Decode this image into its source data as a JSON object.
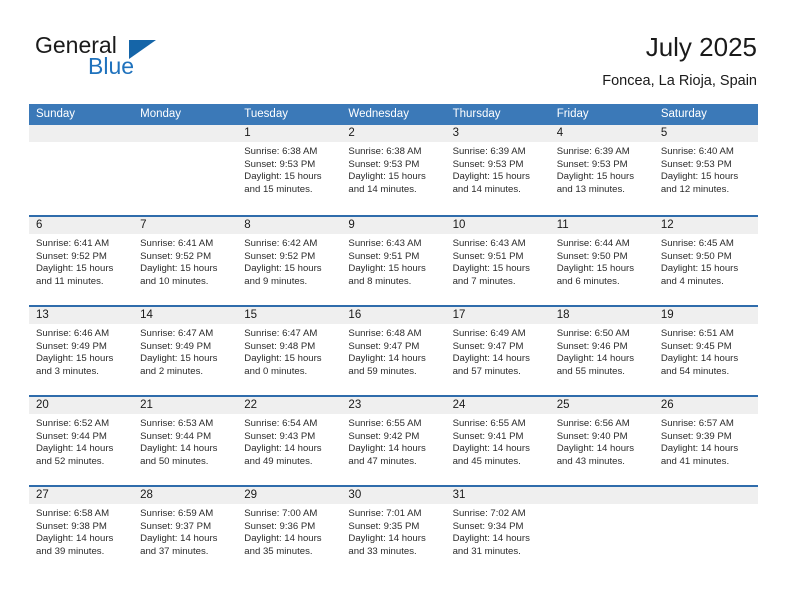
{
  "brand": {
    "name_top": "General",
    "name_bottom": "Blue",
    "triangle_icon": "triangle-icon",
    "color_dark": "#1a1a1a",
    "color_blue": "#1f72bd",
    "color_triangle": "#1565a8"
  },
  "header": {
    "title": "July 2025",
    "subtitle": "Foncea, La Rioja, Spain"
  },
  "theme": {
    "header_blue": "#3b79b8",
    "rule_blue": "#2f6cab",
    "day_band_gray": "#efefef",
    "text": "#1a1a1a"
  },
  "weekdays": [
    "Sunday",
    "Monday",
    "Tuesday",
    "Wednesday",
    "Thursday",
    "Friday",
    "Saturday"
  ],
  "weeks": [
    [
      {
        "day": "",
        "lines": []
      },
      {
        "day": "",
        "lines": []
      },
      {
        "day": "1",
        "lines": [
          "Sunrise: 6:38 AM",
          "Sunset: 9:53 PM",
          "Daylight: 15 hours",
          "and 15 minutes."
        ]
      },
      {
        "day": "2",
        "lines": [
          "Sunrise: 6:38 AM",
          "Sunset: 9:53 PM",
          "Daylight: 15 hours",
          "and 14 minutes."
        ]
      },
      {
        "day": "3",
        "lines": [
          "Sunrise: 6:39 AM",
          "Sunset: 9:53 PM",
          "Daylight: 15 hours",
          "and 14 minutes."
        ]
      },
      {
        "day": "4",
        "lines": [
          "Sunrise: 6:39 AM",
          "Sunset: 9:53 PM",
          "Daylight: 15 hours",
          "and 13 minutes."
        ]
      },
      {
        "day": "5",
        "lines": [
          "Sunrise: 6:40 AM",
          "Sunset: 9:53 PM",
          "Daylight: 15 hours",
          "and 12 minutes."
        ]
      }
    ],
    [
      {
        "day": "6",
        "lines": [
          "Sunrise: 6:41 AM",
          "Sunset: 9:52 PM",
          "Daylight: 15 hours",
          "and 11 minutes."
        ]
      },
      {
        "day": "7",
        "lines": [
          "Sunrise: 6:41 AM",
          "Sunset: 9:52 PM",
          "Daylight: 15 hours",
          "and 10 minutes."
        ]
      },
      {
        "day": "8",
        "lines": [
          "Sunrise: 6:42 AM",
          "Sunset: 9:52 PM",
          "Daylight: 15 hours",
          "and 9 minutes."
        ]
      },
      {
        "day": "9",
        "lines": [
          "Sunrise: 6:43 AM",
          "Sunset: 9:51 PM",
          "Daylight: 15 hours",
          "and 8 minutes."
        ]
      },
      {
        "day": "10",
        "lines": [
          "Sunrise: 6:43 AM",
          "Sunset: 9:51 PM",
          "Daylight: 15 hours",
          "and 7 minutes."
        ]
      },
      {
        "day": "11",
        "lines": [
          "Sunrise: 6:44 AM",
          "Sunset: 9:50 PM",
          "Daylight: 15 hours",
          "and 6 minutes."
        ]
      },
      {
        "day": "12",
        "lines": [
          "Sunrise: 6:45 AM",
          "Sunset: 9:50 PM",
          "Daylight: 15 hours",
          "and 4 minutes."
        ]
      }
    ],
    [
      {
        "day": "13",
        "lines": [
          "Sunrise: 6:46 AM",
          "Sunset: 9:49 PM",
          "Daylight: 15 hours",
          "and 3 minutes."
        ]
      },
      {
        "day": "14",
        "lines": [
          "Sunrise: 6:47 AM",
          "Sunset: 9:49 PM",
          "Daylight: 15 hours",
          "and 2 minutes."
        ]
      },
      {
        "day": "15",
        "lines": [
          "Sunrise: 6:47 AM",
          "Sunset: 9:48 PM",
          "Daylight: 15 hours",
          "and 0 minutes."
        ]
      },
      {
        "day": "16",
        "lines": [
          "Sunrise: 6:48 AM",
          "Sunset: 9:47 PM",
          "Daylight: 14 hours",
          "and 59 minutes."
        ]
      },
      {
        "day": "17",
        "lines": [
          "Sunrise: 6:49 AM",
          "Sunset: 9:47 PM",
          "Daylight: 14 hours",
          "and 57 minutes."
        ]
      },
      {
        "day": "18",
        "lines": [
          "Sunrise: 6:50 AM",
          "Sunset: 9:46 PM",
          "Daylight: 14 hours",
          "and 55 minutes."
        ]
      },
      {
        "day": "19",
        "lines": [
          "Sunrise: 6:51 AM",
          "Sunset: 9:45 PM",
          "Daylight: 14 hours",
          "and 54 minutes."
        ]
      }
    ],
    [
      {
        "day": "20",
        "lines": [
          "Sunrise: 6:52 AM",
          "Sunset: 9:44 PM",
          "Daylight: 14 hours",
          "and 52 minutes."
        ]
      },
      {
        "day": "21",
        "lines": [
          "Sunrise: 6:53 AM",
          "Sunset: 9:44 PM",
          "Daylight: 14 hours",
          "and 50 minutes."
        ]
      },
      {
        "day": "22",
        "lines": [
          "Sunrise: 6:54 AM",
          "Sunset: 9:43 PM",
          "Daylight: 14 hours",
          "and 49 minutes."
        ]
      },
      {
        "day": "23",
        "lines": [
          "Sunrise: 6:55 AM",
          "Sunset: 9:42 PM",
          "Daylight: 14 hours",
          "and 47 minutes."
        ]
      },
      {
        "day": "24",
        "lines": [
          "Sunrise: 6:55 AM",
          "Sunset: 9:41 PM",
          "Daylight: 14 hours",
          "and 45 minutes."
        ]
      },
      {
        "day": "25",
        "lines": [
          "Sunrise: 6:56 AM",
          "Sunset: 9:40 PM",
          "Daylight: 14 hours",
          "and 43 minutes."
        ]
      },
      {
        "day": "26",
        "lines": [
          "Sunrise: 6:57 AM",
          "Sunset: 9:39 PM",
          "Daylight: 14 hours",
          "and 41 minutes."
        ]
      }
    ],
    [
      {
        "day": "27",
        "lines": [
          "Sunrise: 6:58 AM",
          "Sunset: 9:38 PM",
          "Daylight: 14 hours",
          "and 39 minutes."
        ]
      },
      {
        "day": "28",
        "lines": [
          "Sunrise: 6:59 AM",
          "Sunset: 9:37 PM",
          "Daylight: 14 hours",
          "and 37 minutes."
        ]
      },
      {
        "day": "29",
        "lines": [
          "Sunrise: 7:00 AM",
          "Sunset: 9:36 PM",
          "Daylight: 14 hours",
          "and 35 minutes."
        ]
      },
      {
        "day": "30",
        "lines": [
          "Sunrise: 7:01 AM",
          "Sunset: 9:35 PM",
          "Daylight: 14 hours",
          "and 33 minutes."
        ]
      },
      {
        "day": "31",
        "lines": [
          "Sunrise: 7:02 AM",
          "Sunset: 9:34 PM",
          "Daylight: 14 hours",
          "and 31 minutes."
        ]
      },
      {
        "day": "",
        "lines": []
      },
      {
        "day": "",
        "lines": []
      }
    ]
  ]
}
